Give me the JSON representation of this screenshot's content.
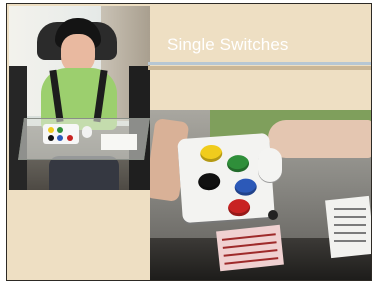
{
  "slide": {
    "title": "Single Switches"
  },
  "photos": {
    "left_icon": "photo-student-in-wheelchair-icon",
    "right_icon": "photo-switch-board-icon"
  },
  "colors": {
    "slide_background": "#eedfc3",
    "title_text": "#ffffff",
    "rule_blue": "#b7c7d3",
    "switch_yellow": "#f0cc1d",
    "switch_green": "#2f8f3a",
    "switch_blue": "#2c59b8",
    "switch_black": "#111111",
    "switch_red": "#c82222"
  }
}
